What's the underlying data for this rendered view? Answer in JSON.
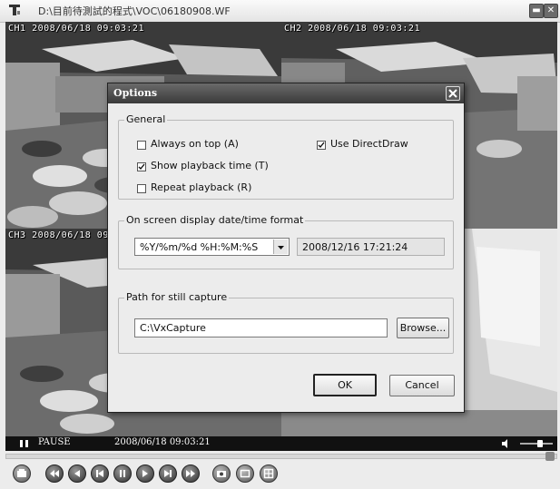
{
  "window": {
    "title": "D:\\目前待測試的程式\\VOC\\06180908.WF",
    "app_icon": "player-app-icon",
    "minimize_icon": "minimize-icon",
    "close_icon": "close-icon"
  },
  "cameras": [
    {
      "label": "CH1 2008/06/18 09:03:21"
    },
    {
      "label": "CH2 2008/06/18 09:03:21"
    },
    {
      "label": "CH3 2008/06/18 09"
    },
    {
      "label": ""
    }
  ],
  "status": {
    "state": "PAUSE",
    "timestamp": "2008/06/18 09:03:21",
    "volume_level": 0.55
  },
  "controls": [
    "settings-icon",
    "rewind-fast-icon",
    "step-back-icon",
    "play-reverse-icon",
    "pause-icon",
    "play-icon",
    "step-forward-icon",
    "fast-forward-icon",
    "snapshot-icon",
    "single-view-icon",
    "quad-view-icon"
  ],
  "dialog": {
    "title": "Options",
    "general": {
      "legend": "General",
      "always_on_top": {
        "label": "Always on top (A)",
        "checked": false
      },
      "show_playback_time": {
        "label": "Show playback time (T)",
        "checked": true
      },
      "repeat_playback": {
        "label": "Repeat playback (R)",
        "checked": false
      },
      "use_directdraw": {
        "label": "Use DirectDraw",
        "checked": true
      }
    },
    "osd": {
      "legend": "On screen display date/time format",
      "format_value": "%Y/%m/%d %H:%M:%S",
      "preview": "2008/12/16 17:21:24"
    },
    "capture": {
      "legend": "Path for still capture",
      "path_value": "C:\\VxCapture",
      "browse_label": "Browse..."
    },
    "ok_label": "OK",
    "cancel_label": "Cancel"
  }
}
